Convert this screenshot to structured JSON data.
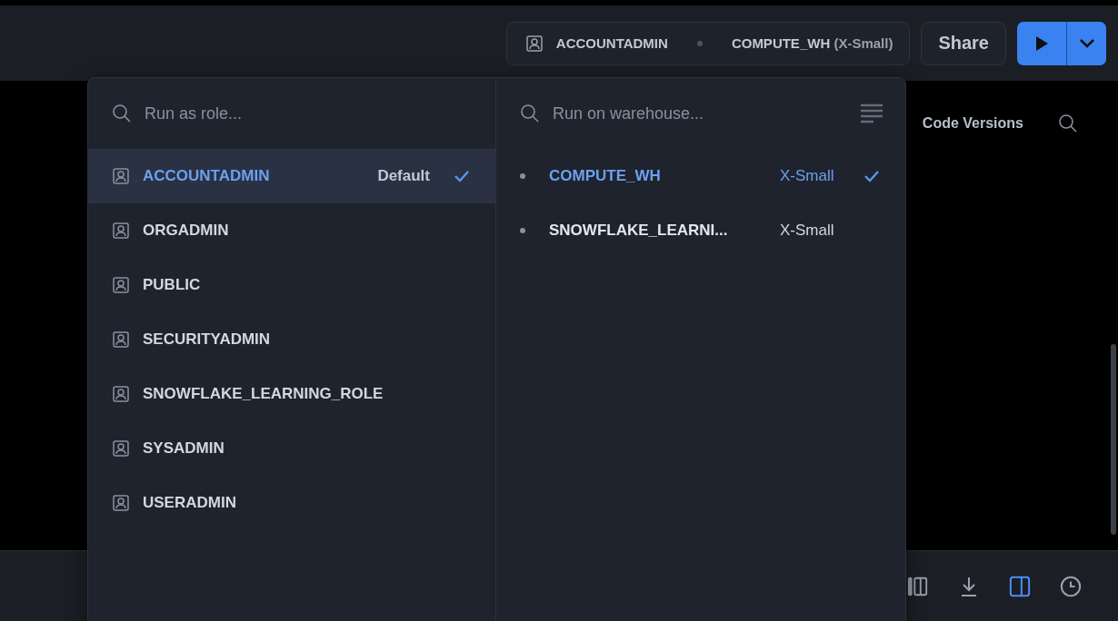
{
  "toolbar": {
    "context": {
      "role": "ACCOUNTADMIN",
      "warehouse": "COMPUTE_WH",
      "size": "(X-Small)"
    },
    "share": "Share"
  },
  "editor_header": {
    "code_versions": "Code Versions"
  },
  "bottom_toolbar": [
    {
      "kind": "columns",
      "selected": false
    },
    {
      "kind": "download",
      "selected": false
    },
    {
      "kind": "panel",
      "selected": true
    },
    {
      "kind": "history",
      "selected": false
    }
  ],
  "popover": {
    "roles": {
      "placeholder": "Run as role...",
      "items": [
        {
          "name": "ACCOUNTADMIN",
          "note": "Default",
          "selected": true
        },
        {
          "name": "ORGADMIN",
          "selected": false
        },
        {
          "name": "PUBLIC",
          "selected": false
        },
        {
          "name": "SECURITYADMIN",
          "selected": false
        },
        {
          "name": "SNOWFLAKE_LEARNING_ROLE",
          "selected": false
        },
        {
          "name": "SYSADMIN",
          "selected": false
        },
        {
          "name": "USERADMIN",
          "selected": false
        }
      ]
    },
    "warehouses": {
      "placeholder": "Run on warehouse...",
      "items": [
        {
          "name": "COMPUTE_WH",
          "size": "X-Small",
          "selected": true
        },
        {
          "name": "SNOWFLAKE_LEARNI...",
          "size": "X-Small",
          "selected": false
        }
      ]
    }
  }
}
